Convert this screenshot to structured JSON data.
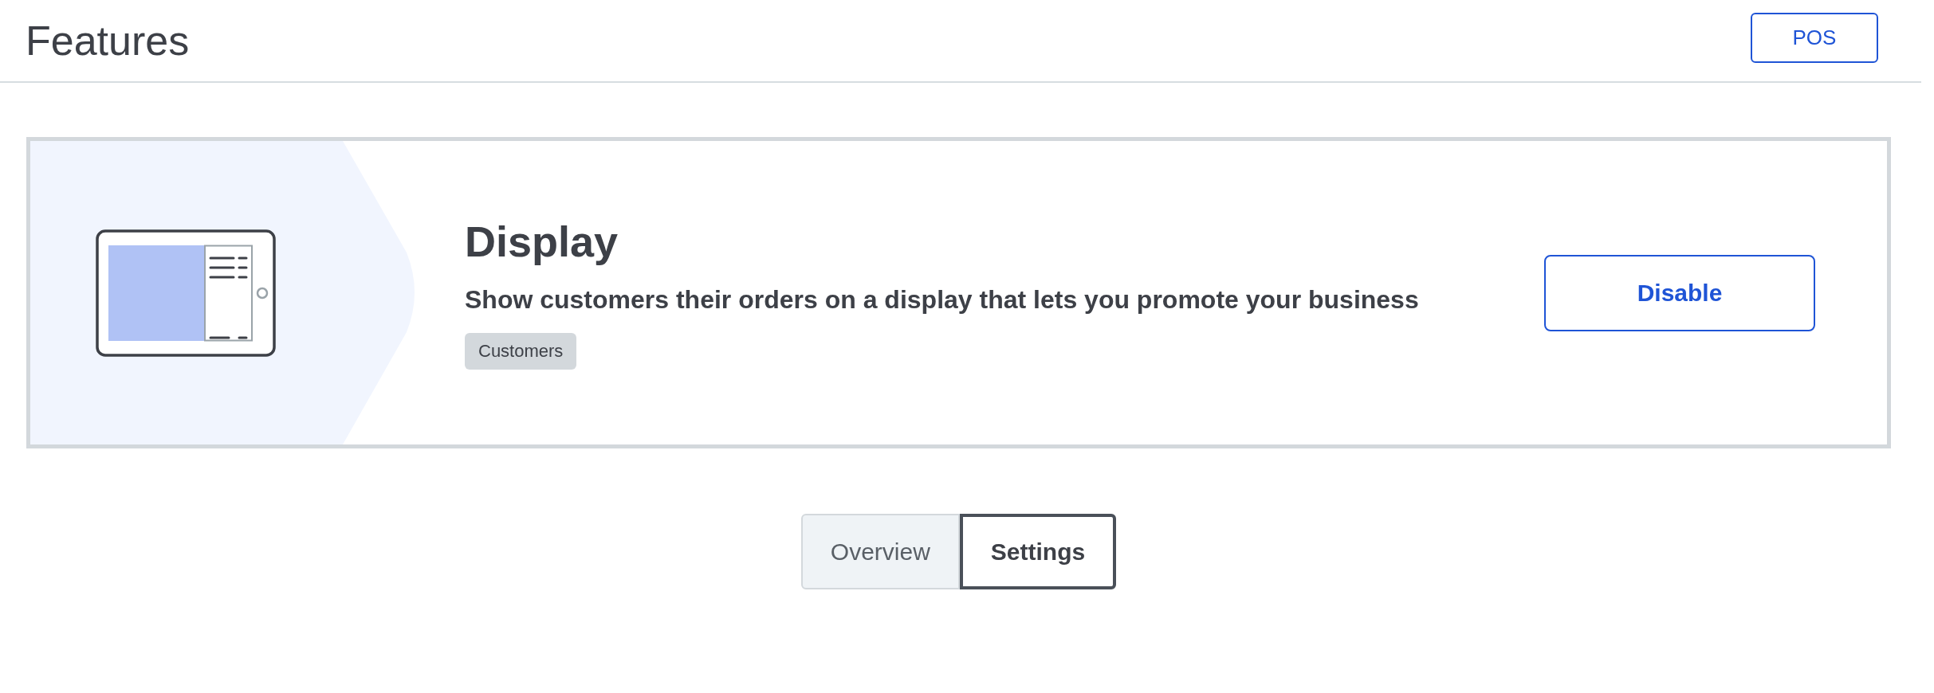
{
  "header": {
    "title": "Features",
    "button": "POS"
  },
  "feature": {
    "title": "Display",
    "description": "Show customers their orders on a display that lets you promote your business",
    "tags": [
      "Customers"
    ],
    "action": "Disable"
  },
  "tabs": [
    {
      "label": "Overview",
      "selected": false
    },
    {
      "label": "Settings",
      "selected": true
    }
  ]
}
